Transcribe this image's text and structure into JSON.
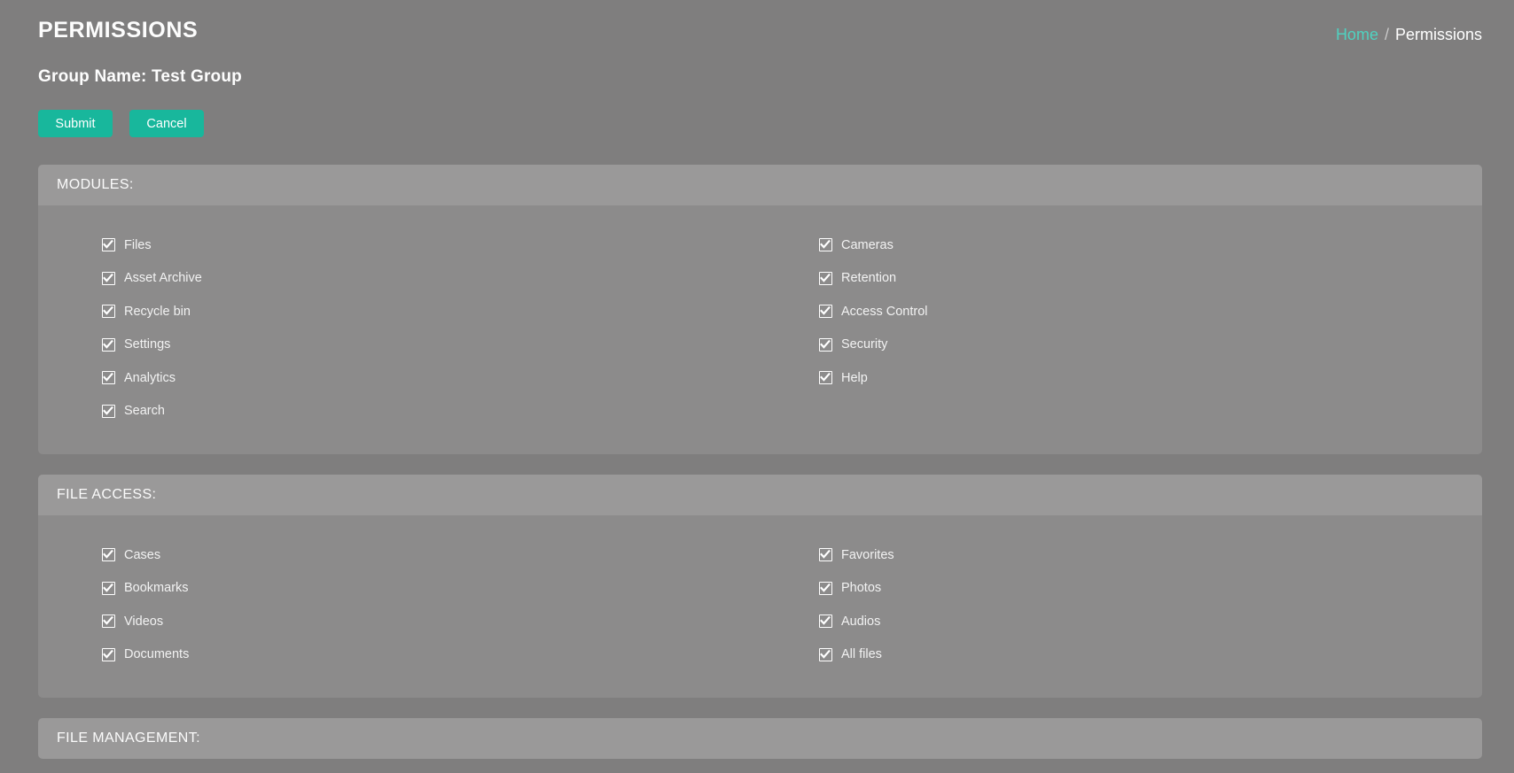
{
  "header": {
    "title": "PERMISSIONS",
    "breadcrumb": {
      "home": "Home",
      "separator": "/",
      "current": "Permissions"
    }
  },
  "group": {
    "label": "Group Name: Test Group"
  },
  "actions": {
    "submit_label": "Submit",
    "cancel_label": "Cancel"
  },
  "colors": {
    "page_background": "#7f7e7e",
    "panel_background": "#8c8b8b",
    "panel_header_background": "#9a9999",
    "accent_teal": "#18b79c",
    "breadcrumb_link": "#4fd2c0",
    "text": "#ffffff"
  },
  "panels": [
    {
      "title": "MODULES:",
      "left_column": [
        {
          "label": "Files",
          "checked": true
        },
        {
          "label": "Asset Archive",
          "checked": true
        },
        {
          "label": "Recycle bin",
          "checked": true
        },
        {
          "label": "Settings",
          "checked": true
        },
        {
          "label": "Analytics",
          "checked": true
        },
        {
          "label": "Search",
          "checked": true
        }
      ],
      "right_column": [
        {
          "label": "Cameras",
          "checked": true
        },
        {
          "label": "Retention",
          "checked": true
        },
        {
          "label": "Access Control",
          "checked": true
        },
        {
          "label": "Security",
          "checked": true
        },
        {
          "label": "Help",
          "checked": true
        }
      ]
    },
    {
      "title": "FILE ACCESS:",
      "left_column": [
        {
          "label": "Cases",
          "checked": true
        },
        {
          "label": "Bookmarks",
          "checked": true
        },
        {
          "label": "Videos",
          "checked": true
        },
        {
          "label": "Documents",
          "checked": true
        }
      ],
      "right_column": [
        {
          "label": "Favorites",
          "checked": true
        },
        {
          "label": "Photos",
          "checked": true
        },
        {
          "label": "Audios",
          "checked": true
        },
        {
          "label": "All files",
          "checked": true
        }
      ]
    },
    {
      "title": "FILE MANAGEMENT:",
      "left_column": [],
      "right_column": []
    }
  ]
}
